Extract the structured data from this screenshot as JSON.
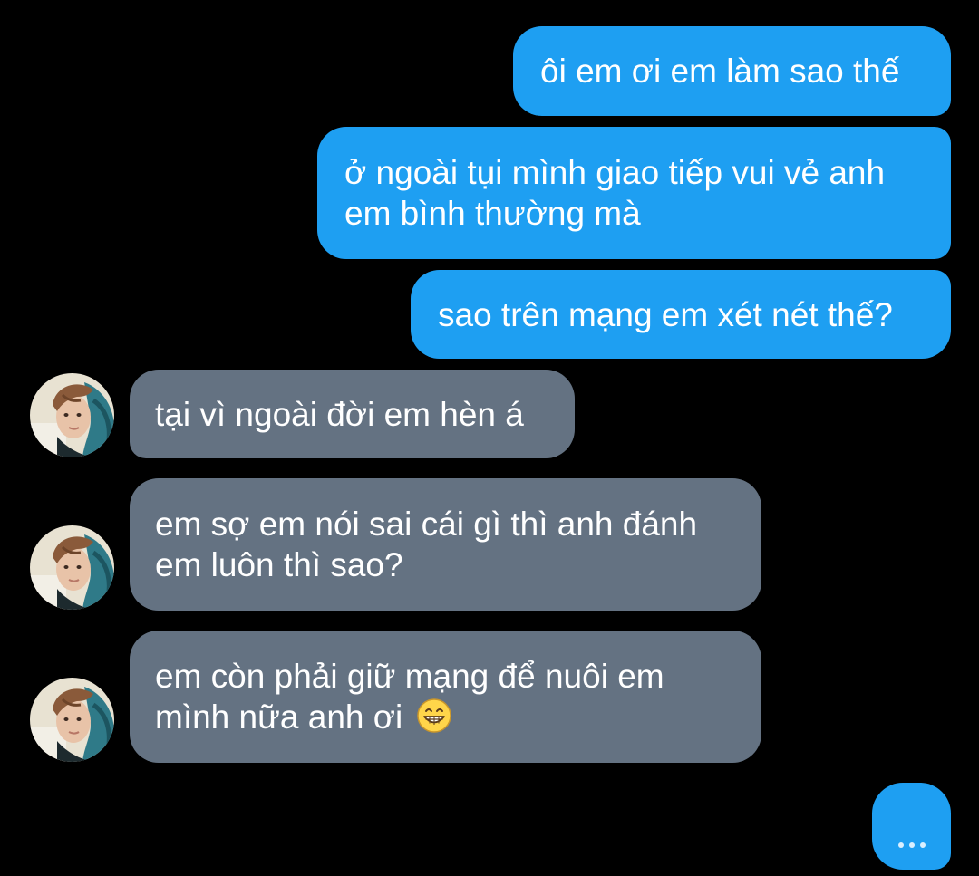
{
  "conversation": {
    "sent": [
      {
        "lines": [
          "ôi em ơi em làm sao thế"
        ]
      },
      {
        "lines": [
          "ở ngoài tụi mình giao tiếp vui vẻ anh",
          "em bình thường mà"
        ]
      },
      {
        "lines": [
          "sao trên mạng em xét nét thế?"
        ]
      }
    ],
    "received": [
      {
        "lines": [
          "tại vì ngoài đời em hèn á"
        ]
      },
      {
        "lines": [
          "em sợ em nói sai cái gì thì anh đánh",
          "em luôn thì sao?"
        ]
      },
      {
        "lines": [
          "em còn phải giữ mạng để nuôi em",
          "mình nữa anh ơi"
        ],
        "emoji": "grinning-face-icon"
      }
    ],
    "typing_indicator": "…"
  },
  "colors": {
    "background": "#000000",
    "sent_bubble": "#1e9ff2",
    "received_bubble": "#647282",
    "text": "#ffffff"
  }
}
